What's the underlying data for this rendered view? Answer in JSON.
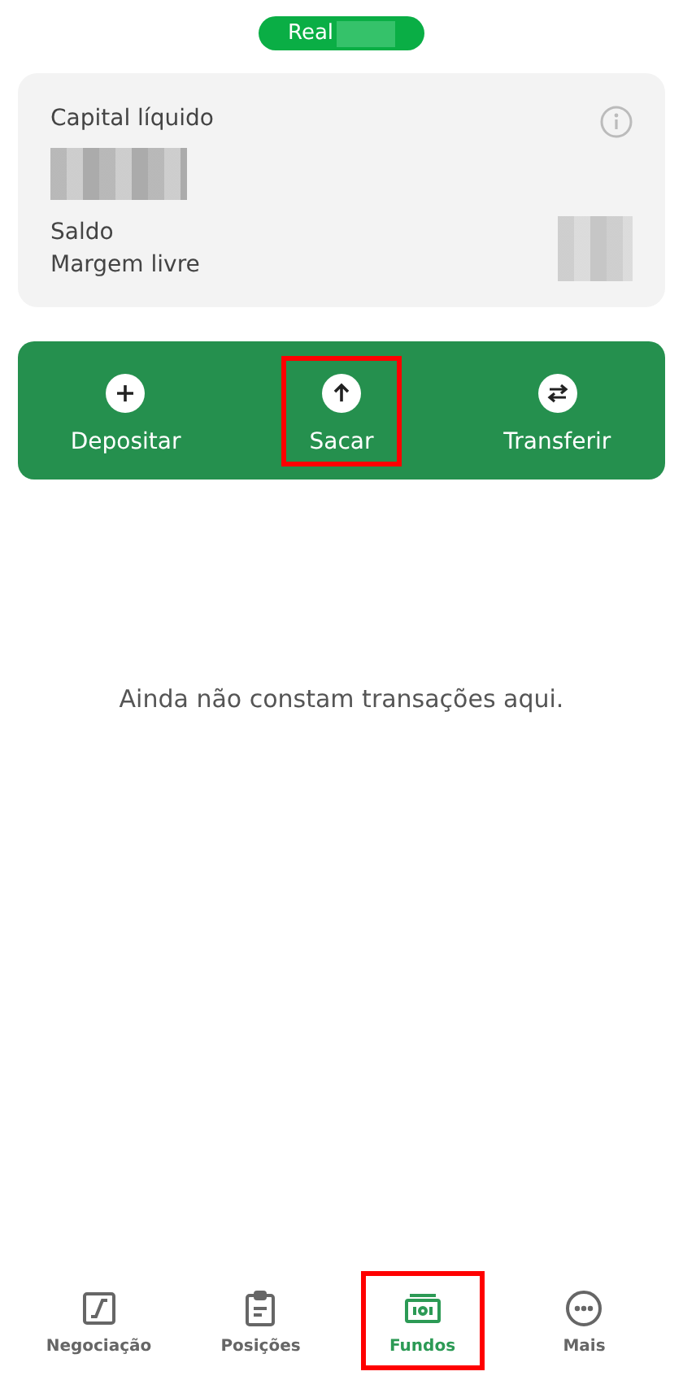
{
  "account_badge": {
    "label": "Real"
  },
  "summary": {
    "title": "Capital líquido",
    "rows": [
      {
        "label": "Saldo"
      },
      {
        "label": "Margem livre"
      }
    ]
  },
  "actions": [
    {
      "kind": "plus",
      "label": "Depositar",
      "highlighted": false
    },
    {
      "kind": "up",
      "label": "Sacar",
      "highlighted": true
    },
    {
      "kind": "swap",
      "label": "Transferir",
      "highlighted": false
    }
  ],
  "empty_message": "Ainda não constam transações aqui.",
  "tabs": [
    {
      "kind": "chart",
      "label": "Negociação",
      "selected": false,
      "highlighted": false
    },
    {
      "kind": "clipboard",
      "label": "Posições",
      "selected": false,
      "highlighted": false
    },
    {
      "kind": "cash",
      "label": "Fundos",
      "selected": true,
      "highlighted": true
    },
    {
      "kind": "more",
      "label": "Mais",
      "selected": false,
      "highlighted": false
    }
  ]
}
